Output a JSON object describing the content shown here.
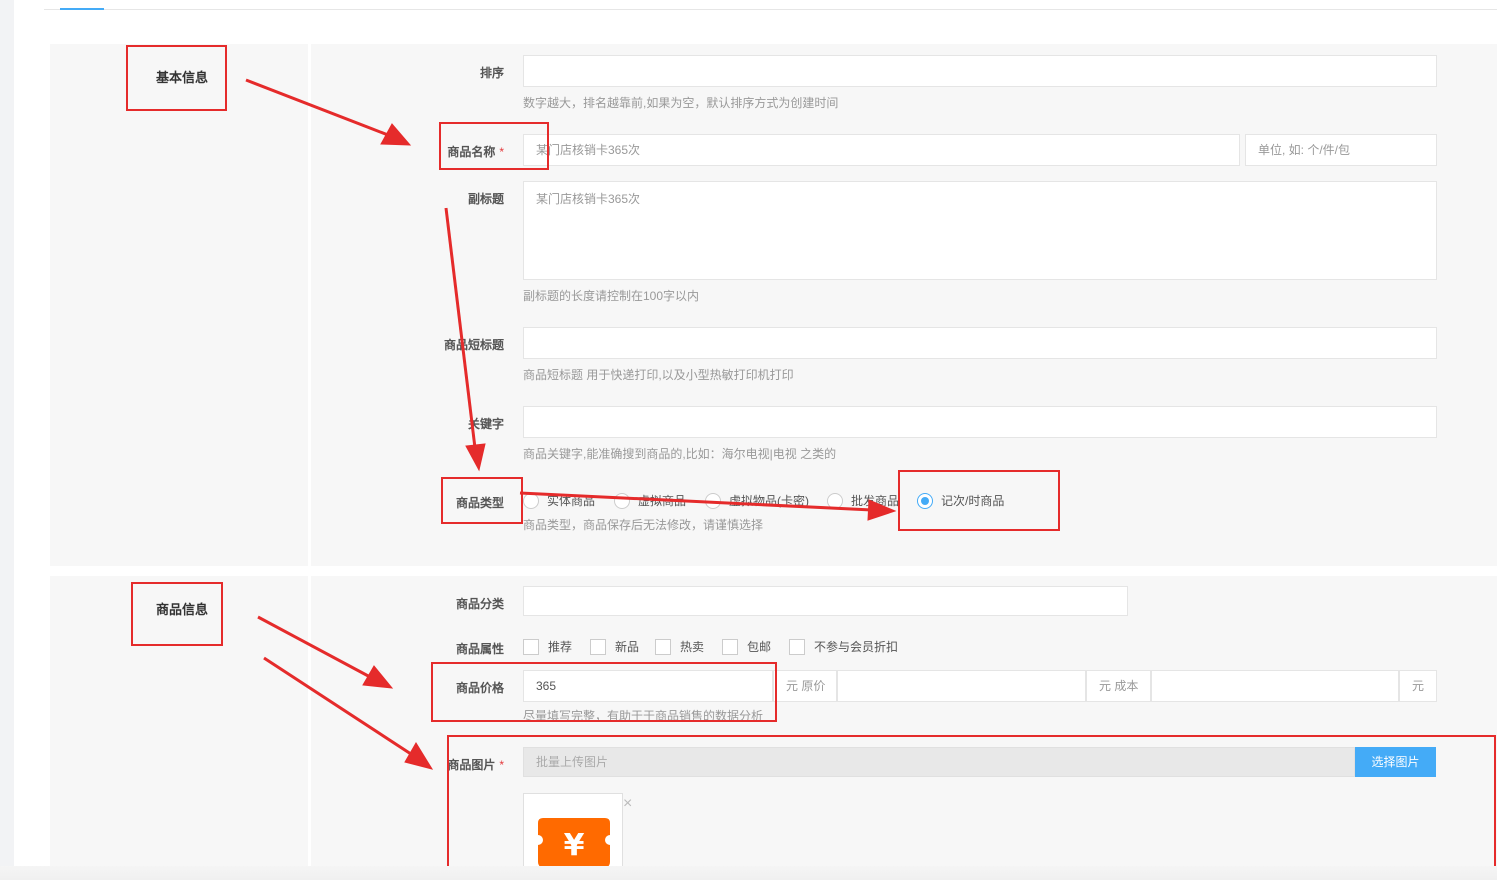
{
  "sections": {
    "basic_title": "基本信息",
    "goods_title": "商品信息"
  },
  "form": {
    "sort": {
      "label": "排序",
      "value": "",
      "help": "数字越大，排名越靠前,如果为空，默认排序方式为创建时间"
    },
    "name": {
      "label": "商品名称",
      "required_mark": "*",
      "placeholder": "某门店核销卡365次",
      "unit_placeholder": "单位, 如: 个/件/包"
    },
    "subtitle": {
      "label": "副标题",
      "placeholder": "某门店核销卡365次",
      "help": "副标题的长度请控制在100字以内"
    },
    "short_title": {
      "label": "商品短标题",
      "value": "",
      "help": "商品短标题 用于快递打印,以及小型热敏打印机打印"
    },
    "keywords": {
      "label": "关键字",
      "value": "",
      "help": "商品关键字,能准确搜到商品的,比如：海尔电视|电视 之类的"
    },
    "type": {
      "label": "商品类型",
      "options": [
        "实体商品",
        "虚拟商品",
        "虚拟物品(卡密)",
        "批发商品",
        "记次/时商品"
      ],
      "selected": "记次/时商品",
      "help": "商品类型，商品保存后无法修改，请谨慎选择"
    },
    "category": {
      "label": "商品分类",
      "value": ""
    },
    "attributes": {
      "label": "商品属性",
      "options": [
        "推荐",
        "新品",
        "热卖",
        "包邮",
        "不参与会员折扣"
      ]
    },
    "price": {
      "label": "商品价格",
      "value": "365",
      "addon_original": "元 原价",
      "addon_cost": "元 成本",
      "addon_yuan": "元",
      "help": "尽量填写完整，有助于于商品销售的数据分析"
    },
    "images": {
      "label": "商品图片",
      "required_mark": "*",
      "placeholder": "批量上传图片",
      "button": "选择图片",
      "close_glyph": "×"
    }
  },
  "thumbnail": {
    "glyph": "¥",
    "color": "#ff6a00"
  },
  "colors": {
    "accent": "#44abf7",
    "annotation": "#e52b2b",
    "required": "#e4393c"
  }
}
